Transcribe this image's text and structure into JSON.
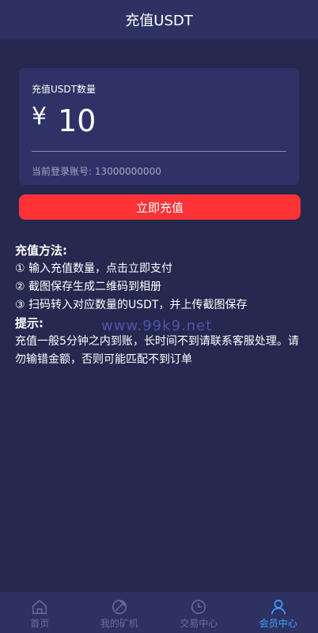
{
  "header": {
    "title": "充值USDT"
  },
  "card": {
    "amount_label": "充值USDT数量",
    "currency_symbol": "¥",
    "amount_value": "10",
    "account_label": "当前登录账号: 13000000000"
  },
  "submit_label": "立即充值",
  "instructions": {
    "method_heading": "充值方法:",
    "steps": [
      "① 输入充值数量，点击立即支付",
      "② 截图保存生成二维码到相册",
      "③ 扫码转入对应数量的USDT，并上传截图保存"
    ],
    "tips_heading": "提示:",
    "tips_text": "充值一般5分钟之内到账，长时间不到请联系客服处理。请勿输错金额，否则可能匹配不到订单"
  },
  "watermark": "www.99k9.net",
  "tabbar": {
    "items": [
      {
        "label": "首页",
        "icon": "home-icon"
      },
      {
        "label": "我的矿机",
        "icon": "miner-icon"
      },
      {
        "label": "交易中心",
        "icon": "clock-icon"
      },
      {
        "label": "会员中心",
        "icon": "user-icon"
      }
    ],
    "active_index": 3,
    "active_color": "#3fa2ff"
  },
  "colors": {
    "background": "#25284f",
    "header": "#2e3263",
    "card": "#2e3266",
    "button": "#ff3336"
  }
}
